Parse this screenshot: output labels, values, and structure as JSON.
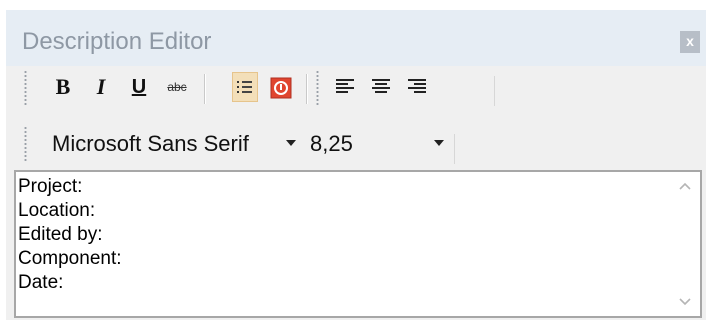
{
  "window": {
    "title": "Description Editor",
    "close_label": "x"
  },
  "toolbar": {
    "bold": "B",
    "italic": "I",
    "underline": "U",
    "strikethrough": "abc",
    "bullet_list_icon": "bullet-list-icon",
    "numbered_list_icon": "numbered-list-icon",
    "align_left_icon": "align-left-icon",
    "align_center_icon": "align-center-icon",
    "align_right_icon": "align-right-icon",
    "active_color": "#f3dfb9",
    "numbered_icon_color": "#e0452f"
  },
  "font": {
    "family_value": "Microsoft Sans Serif",
    "size_value": "8,25"
  },
  "editor": {
    "lines": [
      "Project:",
      "Location:",
      "Edited by:",
      "Component:",
      "Date:"
    ]
  }
}
